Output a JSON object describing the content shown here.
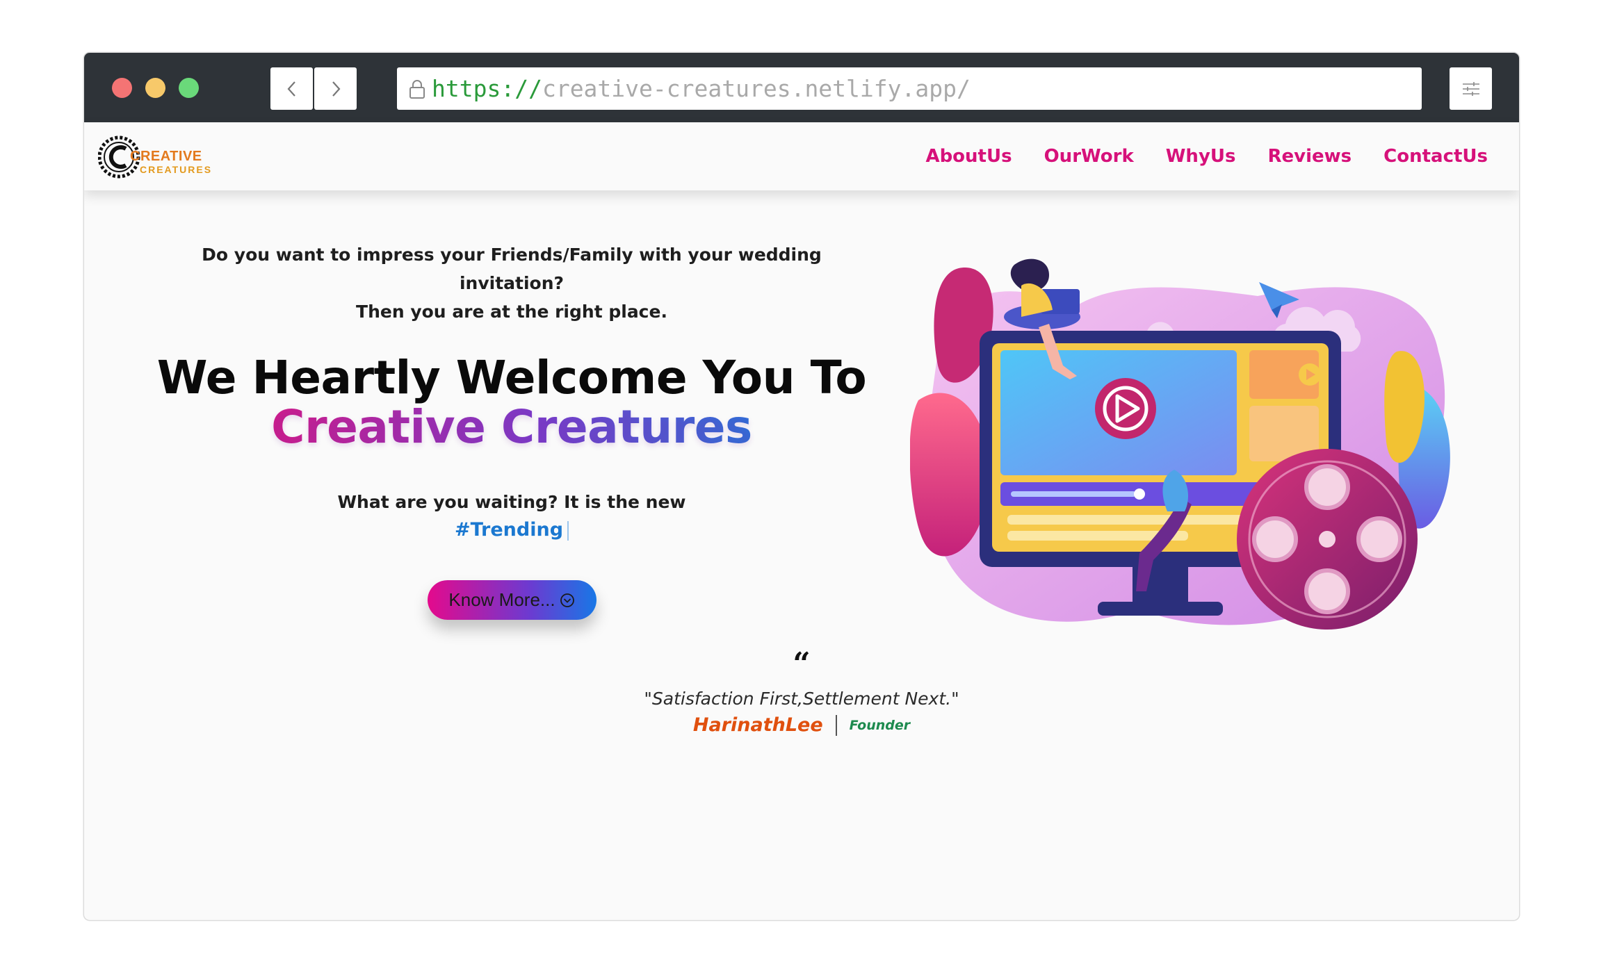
{
  "browser": {
    "url_protocol": "https://",
    "url_rest": "creative-creatures.netlify.app/"
  },
  "site": {
    "logo_line1": "CREATIVE",
    "logo_line2": "CREATURES",
    "nav": [
      "AboutUs",
      "OurWork",
      "WhyUs",
      "Reviews",
      "ContactUs"
    ]
  },
  "hero": {
    "intro_line1": "Do you want to impress your Friends/Family with your wedding invitation?",
    "intro_line2": "Then you are at the right place.",
    "headline": "We Heartly Welcome You To",
    "brand": "Creative Creatures",
    "waiting": "What are you waiting? It is the new",
    "trend": "#Trending",
    "cta_label": "Know More..."
  },
  "quote": {
    "text": "\"Satisfaction First,Settlement Next.\"",
    "author": "HarinathLee",
    "role": "Founder"
  }
}
